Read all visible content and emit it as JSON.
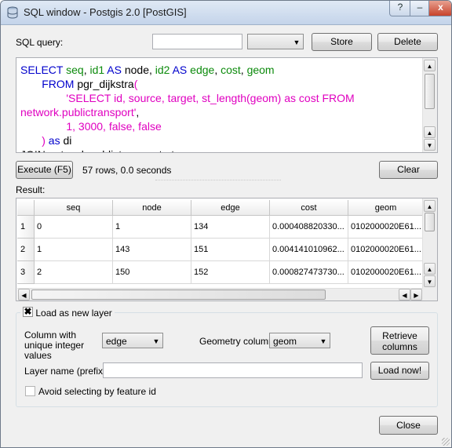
{
  "window": {
    "title": "SQL window - Postgis 2.0 [PostGIS]",
    "help_label": "?",
    "minimize_label": "–",
    "close_label": "x"
  },
  "query_bar": {
    "label": "SQL query:",
    "name_value": "",
    "saved_query_value": "",
    "store_label": "Store",
    "delete_label": "Delete"
  },
  "sql_lines": [
    [
      {
        "t": "SELECT ",
        "c": "kw"
      },
      {
        "t": "seq",
        "c": "fn"
      },
      {
        "t": ", ",
        "c": "pl"
      },
      {
        "t": "id1",
        "c": "fn"
      },
      {
        "t": " AS ",
        "c": "kw"
      },
      {
        "t": "node",
        "c": "pl"
      },
      {
        "t": ", ",
        "c": "pl"
      },
      {
        "t": "id2",
        "c": "fn"
      },
      {
        "t": " AS ",
        "c": "kw"
      },
      {
        "t": "edge",
        "c": "fn"
      },
      {
        "t": ", ",
        "c": "pl"
      },
      {
        "t": "cost",
        "c": "fn"
      },
      {
        "t": ", ",
        "c": "pl"
      },
      {
        "t": "geom",
        "c": "fn"
      }
    ],
    [
      {
        "t": "       FROM ",
        "c": "kw"
      },
      {
        "t": "pgr_dijkstra",
        "c": "pl"
      },
      {
        "t": "(",
        "c": "str"
      }
    ],
    [
      {
        "t": "               'SELECT id, source, target, st_length(geom) as cost FROM",
        "c": "str"
      }
    ],
    [
      {
        "t": "network.publictransport'",
        "c": "str"
      },
      {
        "t": ",",
        "c": "pl"
      }
    ],
    [
      {
        "t": "               1, 3000, false, false",
        "c": "str"
      }
    ],
    [
      {
        "t": "       ) ",
        "c": "str"
      },
      {
        "t": "as ",
        "c": "kw"
      },
      {
        "t": "di",
        "c": "pl"
      }
    ],
    [
      {
        "t": "JOIN network.publictransport pt",
        "c": "pl"
      }
    ]
  ],
  "execute": {
    "execute_label": "Execute (F5)",
    "status": "57 rows, 0.0 seconds",
    "clear_label": "Clear"
  },
  "result": {
    "label": "Result:",
    "columns": [
      "seq",
      "node",
      "edge",
      "cost",
      "geom"
    ],
    "rows": [
      {
        "num": "1",
        "cells": [
          "0",
          "1",
          "134",
          "0.000408820330...",
          "0102000020E61..."
        ]
      },
      {
        "num": "2",
        "cells": [
          "1",
          "143",
          "151",
          "0.004141010962...",
          "0102000020E61..."
        ]
      },
      {
        "num": "3",
        "cells": [
          "2",
          "150",
          "152",
          "0.000827473730...",
          "0102000020E61..."
        ]
      }
    ]
  },
  "load_layer": {
    "group_label": "Load as new layer",
    "checked": true,
    "column_label": "Column with unique integer values",
    "column_value": "edge",
    "geometry_label": "Geometry column",
    "geometry_value": "geom",
    "retrieve_label": "Retrieve columns",
    "layer_name_label": "Layer name (prefix)",
    "layer_name_value": "",
    "load_now_label": "Load now!",
    "avoid_label": "Avoid selecting by feature id",
    "avoid_checked": false
  },
  "footer": {
    "close_label": "Close"
  }
}
